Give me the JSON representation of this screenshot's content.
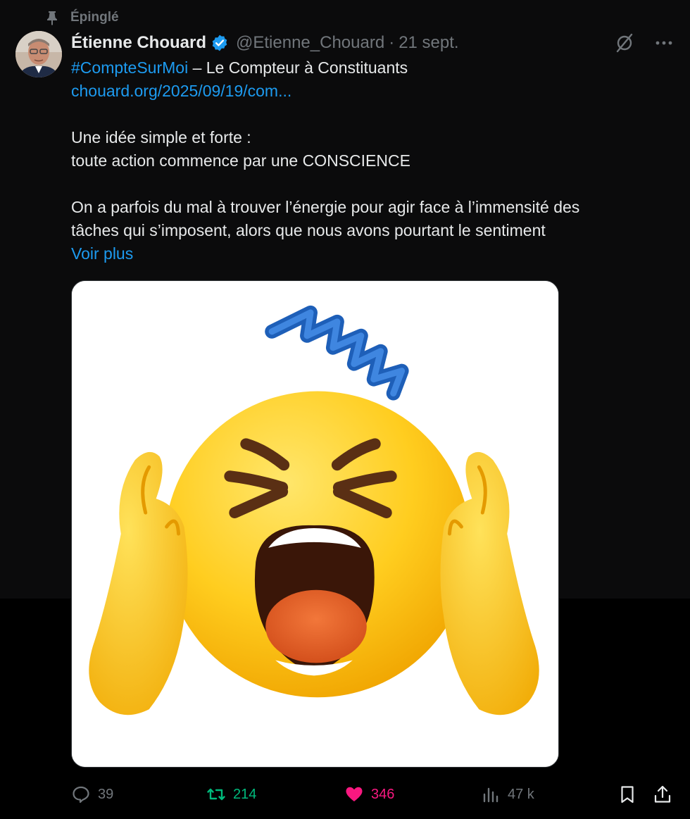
{
  "pinned_label": "Épinglé",
  "author": {
    "name": "Étienne Chouard",
    "handle": "@Etienne_Chouard",
    "date": "21 sept.",
    "verified": true
  },
  "post": {
    "hashtag": "#CompteSurMoi",
    "title_rest": " – Le Compteur à Constituants",
    "link": "chouard.org/2025/09/19/com...",
    "line1": "Une idée simple et forte :",
    "line2": "toute action commence par une CONSCIENCE",
    "line3": "On a parfois du mal à trouver l’énergie pour agir face à l’immensité des",
    "line4": "tâches qui s’imposent, alors que nous avons pourtant le sentiment",
    "see_more": "Voir plus"
  },
  "stats": {
    "replies": "39",
    "reposts": "214",
    "likes": "346",
    "views": "47 k"
  },
  "icons": {
    "pin": "pin-icon",
    "verified": "verified-badge-icon",
    "grok": "grok-icon",
    "more": "more-icon",
    "reply": "reply-icon",
    "retweet": "retweet-icon",
    "like": "heart-icon",
    "views": "views-icon",
    "bookmark": "bookmark-icon",
    "share": "share-icon"
  },
  "colors": {
    "accent_blue": "#1d9bf0",
    "retweet_green": "#00ba7c",
    "like_pink": "#f91880",
    "muted": "#71767b"
  }
}
